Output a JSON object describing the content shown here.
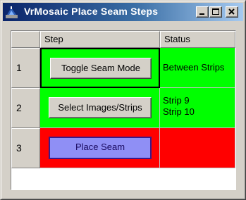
{
  "window": {
    "title": "VrMosaic Place Seam Steps",
    "icon": "vrmosaic-app-icon",
    "controls": [
      "minimize-icon",
      "maximize-icon",
      "close-icon"
    ]
  },
  "grid": {
    "columns": [
      "Step",
      "Status"
    ],
    "rows": [
      {
        "number": "1",
        "button": "Toggle Seam Mode",
        "status": [
          "Between Strips"
        ],
        "color": "#00ff00"
      },
      {
        "number": "2",
        "button": "Select Images/Strips",
        "status": [
          "Strip 9",
          "Strip 10"
        ],
        "color": "#00ff00"
      },
      {
        "number": "3",
        "button": "Place Seam",
        "status": [],
        "color": "#ff0000"
      }
    ]
  },
  "colors": {
    "done": "#00ff00",
    "pending": "#ff0000",
    "active_button": "#8f8ff5"
  }
}
